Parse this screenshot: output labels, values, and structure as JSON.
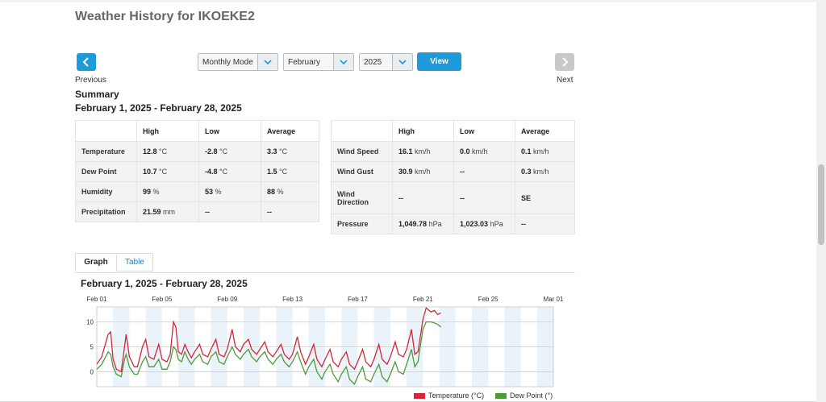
{
  "page": {
    "title": "Weather History for IKOEKE2"
  },
  "nav": {
    "previous_label": "Previous",
    "next_label": "Next",
    "previous_icon": "chevron-left-icon",
    "next_icon": "chevron-right-icon"
  },
  "filters": {
    "mode": "Monthly Mode",
    "month": "February",
    "year": "2025",
    "view_label": "View"
  },
  "summary": {
    "title": "Summary",
    "range": "February 1, 2025 - February 28, 2025",
    "headers": [
      "High",
      "Low",
      "Average"
    ],
    "left_rows": [
      {
        "label": "Temperature",
        "high": "12.8",
        "high_unit": "°C",
        "low": "-2.8",
        "low_unit": "°C",
        "avg": "3.3",
        "avg_unit": "°C"
      },
      {
        "label": "Dew Point",
        "high": "10.7",
        "high_unit": "°C",
        "low": "-4.8",
        "low_unit": "°C",
        "avg": "1.5",
        "avg_unit": "°C"
      },
      {
        "label": "Humidity",
        "high": "99",
        "high_unit": "%",
        "low": "53",
        "low_unit": "%",
        "avg": "88",
        "avg_unit": "%"
      },
      {
        "label": "Precipitation",
        "high": "21.59",
        "high_unit": "mm",
        "low": "--",
        "low_unit": "",
        "avg": "--",
        "avg_unit": ""
      }
    ],
    "right_rows": [
      {
        "label": "Wind Speed",
        "high": "16.1",
        "high_unit": "km/h",
        "low": "0.0",
        "low_unit": "km/h",
        "avg": "0.1",
        "avg_unit": "km/h"
      },
      {
        "label": "Wind Gust",
        "high": "30.9",
        "high_unit": "km/h",
        "low": "--",
        "low_unit": "",
        "avg": "0.3",
        "avg_unit": "km/h"
      },
      {
        "label": "Wind Direction",
        "high": "--",
        "high_unit": "",
        "low": "--",
        "low_unit": "",
        "avg": "SE",
        "avg_unit": ""
      },
      {
        "label": "Pressure",
        "high": "1,049.78",
        "high_unit": "hPa",
        "low": "1,023.03",
        "low_unit": "hPa",
        "avg": "--",
        "avg_unit": ""
      }
    ]
  },
  "tabs": [
    {
      "label": "Graph",
      "active": true
    },
    {
      "label": "Table",
      "active": false
    }
  ],
  "chart_data": {
    "type": "line",
    "title": "February 1, 2025 - February 28, 2025",
    "x_ticks": [
      "Feb 01",
      "Feb 05",
      "Feb 09",
      "Feb 13",
      "Feb 17",
      "Feb 21",
      "Feb 25",
      "Mar 01"
    ],
    "x_tick_days": [
      0,
      4,
      8,
      12,
      16,
      20,
      24,
      28
    ],
    "ylim": [
      -3,
      13
    ],
    "y_ticks": [
      0,
      5,
      10
    ],
    "grid": true,
    "legend_position": "bottom-right",
    "series": [
      {
        "name": "Temperature (°C)",
        "color": "#d3263a",
        "points": [
          [
            0.0,
            1.5
          ],
          [
            0.3,
            3.0
          ],
          [
            0.7,
            7.5
          ],
          [
            0.85,
            8.0
          ],
          [
            1.0,
            2.5
          ],
          [
            1.2,
            0.5
          ],
          [
            1.5,
            0.0
          ],
          [
            1.7,
            5.0
          ],
          [
            1.8,
            7.5
          ],
          [
            2.0,
            3.0
          ],
          [
            2.3,
            1.0
          ],
          [
            2.5,
            1.0
          ],
          [
            2.8,
            5.0
          ],
          [
            3.0,
            6.5
          ],
          [
            3.2,
            3.0
          ],
          [
            3.5,
            2.5
          ],
          [
            3.8,
            5.5
          ],
          [
            4.0,
            2.5
          ],
          [
            4.3,
            2.0
          ],
          [
            4.5,
            3.5
          ],
          [
            4.7,
            10.0
          ],
          [
            4.85,
            9.0
          ],
          [
            5.0,
            4.0
          ],
          [
            5.2,
            3.5
          ],
          [
            5.4,
            5.5
          ],
          [
            5.6,
            4.0
          ],
          [
            5.8,
            2.8
          ],
          [
            6.0,
            4.0
          ],
          [
            6.3,
            5.5
          ],
          [
            6.5,
            3.5
          ],
          [
            6.8,
            3.0
          ],
          [
            7.0,
            4.5
          ],
          [
            7.3,
            6.5
          ],
          [
            7.5,
            3.5
          ],
          [
            7.8,
            3.0
          ],
          [
            8.0,
            4.5
          ],
          [
            8.3,
            8.5
          ],
          [
            8.5,
            5.0
          ],
          [
            8.8,
            4.0
          ],
          [
            9.0,
            5.5
          ],
          [
            9.3,
            6.5
          ],
          [
            9.5,
            4.5
          ],
          [
            9.8,
            3.5
          ],
          [
            10.0,
            4.5
          ],
          [
            10.3,
            6.0
          ],
          [
            10.5,
            4.0
          ],
          [
            10.8,
            3.0
          ],
          [
            11.0,
            4.0
          ],
          [
            11.3,
            5.5
          ],
          [
            11.5,
            3.5
          ],
          [
            11.8,
            2.5
          ],
          [
            12.0,
            3.5
          ],
          [
            12.3,
            7.0
          ],
          [
            12.5,
            4.0
          ],
          [
            12.8,
            1.5
          ],
          [
            13.0,
            3.0
          ],
          [
            13.3,
            5.5
          ],
          [
            13.5,
            2.5
          ],
          [
            13.8,
            1.0
          ],
          [
            14.0,
            2.5
          ],
          [
            14.3,
            4.5
          ],
          [
            14.5,
            2.0
          ],
          [
            14.8,
            1.0
          ],
          [
            15.0,
            2.5
          ],
          [
            15.3,
            4.0
          ],
          [
            15.5,
            1.5
          ],
          [
            15.8,
            0.5
          ],
          [
            16.0,
            2.0
          ],
          [
            16.3,
            4.5
          ],
          [
            16.5,
            2.0
          ],
          [
            16.8,
            1.0
          ],
          [
            17.0,
            2.5
          ],
          [
            17.3,
            5.5
          ],
          [
            17.5,
            2.5
          ],
          [
            17.8,
            1.5
          ],
          [
            18.0,
            3.0
          ],
          [
            18.3,
            6.0
          ],
          [
            18.5,
            3.5
          ],
          [
            18.8,
            3.0
          ],
          [
            19.0,
            4.5
          ],
          [
            19.3,
            8.5
          ],
          [
            19.5,
            3.5
          ],
          [
            19.7,
            4.0
          ],
          [
            20.0,
            10.5
          ],
          [
            20.2,
            12.8
          ],
          [
            20.5,
            12.0
          ],
          [
            20.7,
            12.3
          ],
          [
            20.9,
            11.5
          ],
          [
            21.1,
            11.8
          ]
        ]
      },
      {
        "name": "Dew Point (°)",
        "color": "#4e9a3a",
        "points": [
          [
            0.0,
            0.5
          ],
          [
            0.3,
            1.5
          ],
          [
            0.7,
            4.0
          ],
          [
            0.85,
            3.5
          ],
          [
            1.0,
            1.0
          ],
          [
            1.2,
            -0.5
          ],
          [
            1.5,
            -1.0
          ],
          [
            1.7,
            2.5
          ],
          [
            1.8,
            3.5
          ],
          [
            2.0,
            1.0
          ],
          [
            2.3,
            -0.5
          ],
          [
            2.5,
            -0.5
          ],
          [
            2.8,
            2.0
          ],
          [
            3.0,
            3.0
          ],
          [
            3.2,
            1.0
          ],
          [
            3.5,
            1.0
          ],
          [
            3.8,
            2.5
          ],
          [
            4.0,
            0.5
          ],
          [
            4.3,
            0.5
          ],
          [
            4.5,
            2.0
          ],
          [
            4.7,
            5.0
          ],
          [
            4.85,
            4.5
          ],
          [
            5.0,
            2.5
          ],
          [
            5.2,
            2.0
          ],
          [
            5.4,
            4.0
          ],
          [
            5.6,
            2.5
          ],
          [
            5.8,
            1.5
          ],
          [
            6.0,
            2.5
          ],
          [
            6.3,
            3.5
          ],
          [
            6.5,
            2.0
          ],
          [
            6.8,
            1.5
          ],
          [
            7.0,
            3.0
          ],
          [
            7.3,
            4.0
          ],
          [
            7.5,
            2.0
          ],
          [
            7.8,
            1.5
          ],
          [
            8.0,
            3.0
          ],
          [
            8.3,
            5.0
          ],
          [
            8.5,
            3.5
          ],
          [
            8.8,
            2.5
          ],
          [
            9.0,
            3.5
          ],
          [
            9.3,
            4.5
          ],
          [
            9.5,
            3.0
          ],
          [
            9.8,
            2.0
          ],
          [
            10.0,
            3.0
          ],
          [
            10.3,
            4.0
          ],
          [
            10.5,
            2.5
          ],
          [
            10.8,
            1.5
          ],
          [
            11.0,
            2.5
          ],
          [
            11.3,
            3.5
          ],
          [
            11.5,
            2.0
          ],
          [
            11.8,
            1.0
          ],
          [
            12.0,
            2.0
          ],
          [
            12.3,
            4.0
          ],
          [
            12.5,
            2.0
          ],
          [
            12.8,
            -0.5
          ],
          [
            13.0,
            1.0
          ],
          [
            13.3,
            2.5
          ],
          [
            13.5,
            0.0
          ],
          [
            13.8,
            -1.5
          ],
          [
            14.0,
            0.0
          ],
          [
            14.3,
            1.5
          ],
          [
            14.5,
            -0.5
          ],
          [
            14.8,
            -2.0
          ],
          [
            15.0,
            -0.5
          ],
          [
            15.3,
            1.0
          ],
          [
            15.5,
            -1.5
          ],
          [
            15.8,
            -2.5
          ],
          [
            16.0,
            -1.0
          ],
          [
            16.3,
            1.0
          ],
          [
            16.5,
            -1.5
          ],
          [
            16.8,
            -2.0
          ],
          [
            17.0,
            -0.5
          ],
          [
            17.3,
            1.5
          ],
          [
            17.5,
            -1.0
          ],
          [
            17.8,
            -2.0
          ],
          [
            18.0,
            -0.5
          ],
          [
            18.3,
            2.0
          ],
          [
            18.5,
            0.0
          ],
          [
            18.8,
            -0.5
          ],
          [
            19.0,
            1.5
          ],
          [
            19.3,
            4.5
          ],
          [
            19.5,
            1.0
          ],
          [
            19.7,
            2.0
          ],
          [
            20.0,
            8.5
          ],
          [
            20.2,
            10.0
          ],
          [
            20.5,
            10.0
          ],
          [
            20.7,
            9.8
          ],
          [
            20.9,
            9.5
          ],
          [
            21.1,
            9.0
          ]
        ]
      }
    ]
  }
}
